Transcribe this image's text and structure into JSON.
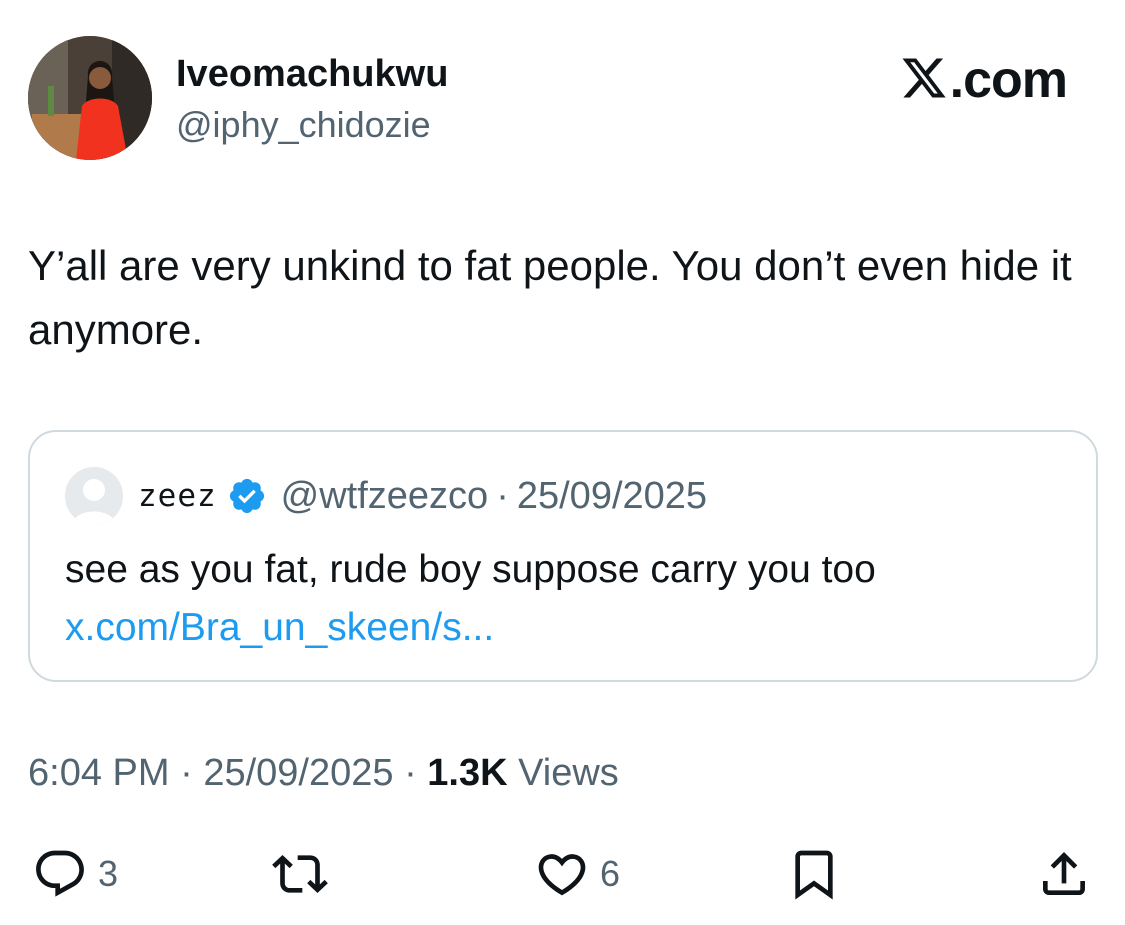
{
  "author": {
    "display_name": "Iveomachukwu",
    "handle": "@iphy_chidozie"
  },
  "brand": {
    "label": ".com",
    "icon": "x-logo-icon"
  },
  "tweet": {
    "text": "Y’all are very unkind to fat people. You don’t even hide it anymore."
  },
  "quoted_tweet": {
    "name": "zeez",
    "verified": true,
    "handle": "@wtfzeezco",
    "separator": "·",
    "date": "25/09/2025",
    "text": "see as you fat, rude boy suppose carry you too",
    "link": "x.com/Bra_un_skeen/s..."
  },
  "meta": {
    "time": "6:04 PM",
    "separator": "·",
    "date": "25/09/2025",
    "views_count": "1.3K",
    "views_label": "Views"
  },
  "actions": {
    "reply_count": "3",
    "like_count": "6"
  },
  "colors": {
    "text_primary": "#0f1419",
    "text_secondary": "#536471",
    "link": "#1d9bf0",
    "verified": "#1d9bf0",
    "border": "#cfd9de"
  }
}
